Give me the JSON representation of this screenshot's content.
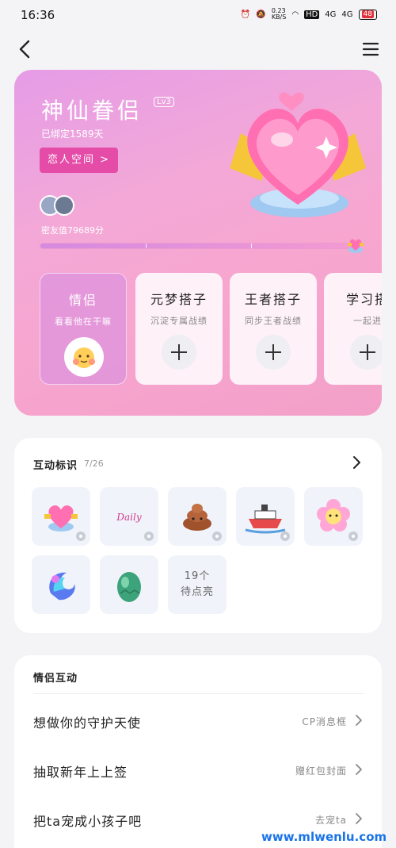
{
  "status_bar": {
    "time": "16:36",
    "net_speed": "0.23\nKB/S",
    "hd": "HD",
    "signal1": "4G",
    "signal2": "4G",
    "battery": "48"
  },
  "hero": {
    "title": "神仙眷侣",
    "level": "Lv3",
    "bind_days": "已绑定1589天",
    "space_button": "恋人空间 >",
    "intimacy": "密友值79689分",
    "progress": 1.0
  },
  "relations": [
    {
      "title": "情侣",
      "subtitle": "看看他在干嘛"
    },
    {
      "title": "元梦搭子",
      "subtitle": "沉淀专属战绩"
    },
    {
      "title": "王者搭子",
      "subtitle": "同步王者战绩"
    },
    {
      "title": "学习搭",
      "subtitle": "一起进"
    }
  ],
  "badges": {
    "title": "互动标识",
    "count": "7/26",
    "icons": [
      "heart-trophy-badge-icon",
      "gift-text-badge-icon",
      "poop-badge-icon",
      "ship-badge-icon",
      "flower-badge-icon",
      "wave-badge-icon",
      "egg-badge-icon"
    ],
    "more_line1": "19个",
    "more_line2": "待点亮"
  },
  "interact": {
    "title": "情侣互动",
    "rows": [
      {
        "label": "想做你的守护天使",
        "right": "CP消息框"
      },
      {
        "label": "抽取新年上上签",
        "right": "赠红包封面"
      },
      {
        "label": "把ta宠成小孩子吧",
        "right": "去宠ta"
      }
    ]
  },
  "watermark": "www.mlwenlu.com",
  "colors": {
    "accent": "#e54ca8",
    "hero_start": "#e59ce6",
    "hero_end": "#f3a0c9"
  }
}
